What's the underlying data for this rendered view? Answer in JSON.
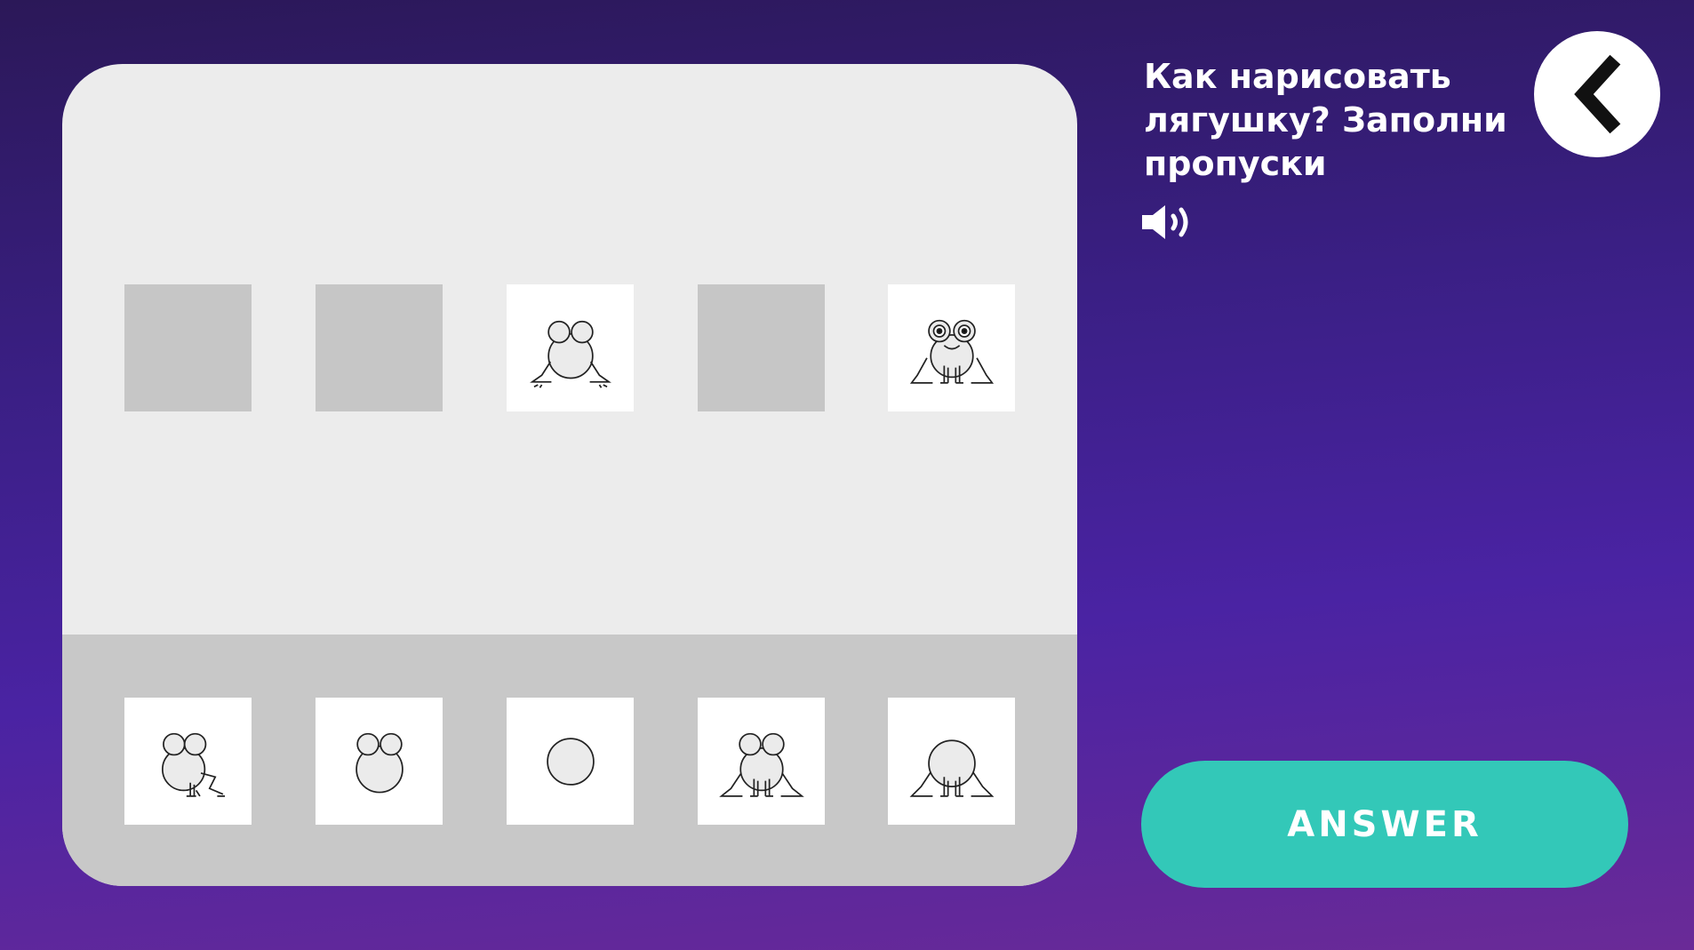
{
  "task": {
    "prompt": "Как нарисовать лягушку? Заполни пропуски",
    "sound_icon": "speaker-icon",
    "back_icon": "chevron-left-icon"
  },
  "sequence_slots": [
    {
      "state": "empty",
      "drawing": null
    },
    {
      "state": "empty",
      "drawing": null
    },
    {
      "state": "filled",
      "drawing": "frog-step-3"
    },
    {
      "state": "empty",
      "drawing": null
    },
    {
      "state": "filled",
      "drawing": "frog-final"
    }
  ],
  "option_cards": [
    {
      "drawing": "frog-step-4"
    },
    {
      "drawing": "frog-step-2"
    },
    {
      "drawing": "frog-step-1"
    },
    {
      "drawing": "frog-step-5"
    },
    {
      "drawing": "frog-step-4b"
    }
  ],
  "buttons": {
    "answer_label": "ANSWER"
  },
  "colors": {
    "answer_button": "#33c8b8",
    "board": "#ececec",
    "tray": "#c8c8c8",
    "empty_slot": "#c6c6c6"
  }
}
